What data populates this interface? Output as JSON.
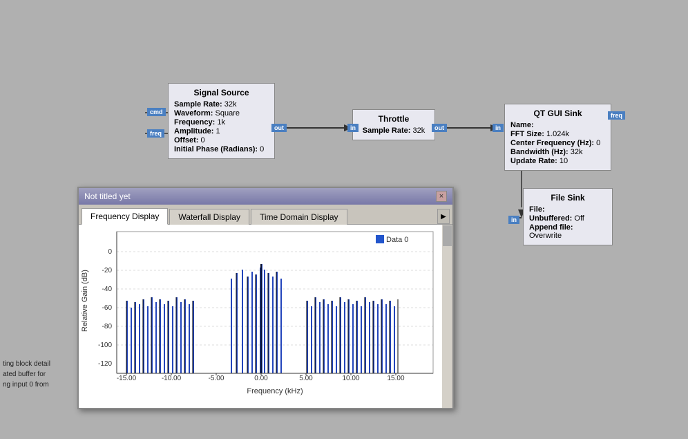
{
  "blocks": {
    "signal_source": {
      "title": "Signal Source",
      "props": [
        {
          "label": "Sample Rate:",
          "value": "32k"
        },
        {
          "label": "Waveform:",
          "value": "Square"
        },
        {
          "label": "Frequency:",
          "value": "1k"
        },
        {
          "label": "Amplitude:",
          "value": "1"
        },
        {
          "label": "Offset:",
          "value": "0"
        },
        {
          "label": "Initial Phase (Radians):",
          "value": "0"
        }
      ],
      "ports": {
        "left": [
          "cmd",
          "freq"
        ],
        "right": [
          "out"
        ]
      }
    },
    "throttle": {
      "title": "Throttle",
      "props": [
        {
          "label": "Sample Rate:",
          "value": "32k"
        }
      ],
      "ports": {
        "left": [
          "in"
        ],
        "right": [
          "out"
        ]
      }
    },
    "qt_gui_sink": {
      "title": "QT GUI Sink",
      "props": [
        {
          "label": "Name:",
          "value": ""
        },
        {
          "label": "FFT Size:",
          "value": "1.024k"
        },
        {
          "label": "Center Frequency (Hz):",
          "value": "0"
        },
        {
          "label": "Bandwidth (Hz):",
          "value": "32k"
        },
        {
          "label": "Update Rate:",
          "value": "10"
        }
      ],
      "ports": {
        "left": [
          "in"
        ],
        "right": [
          "freq"
        ]
      }
    },
    "file_sink": {
      "title": "File Sink",
      "props": [
        {
          "label": "File:",
          "value": ""
        },
        {
          "label": "Unbuffered:",
          "value": "Off"
        },
        {
          "label": "Append file:",
          "value": "Overwrite"
        }
      ],
      "ports": {
        "left": [
          "in"
        ]
      }
    }
  },
  "popup": {
    "title": "Not titled yet",
    "close_label": "×",
    "tabs": [
      {
        "label": "Frequency Display",
        "active": true
      },
      {
        "label": "Waterfall Display",
        "active": false
      },
      {
        "label": "Time Domain Display",
        "active": false
      }
    ],
    "scroll_btn": "▶",
    "chart": {
      "legend": "Data 0",
      "y_axis_label": "Relative Gain (dB)",
      "x_axis_label": "Frequency (kHz)",
      "y_ticks": [
        "0",
        "-20",
        "-40",
        "-60",
        "-80",
        "-100",
        "-120"
      ],
      "x_ticks": [
        "-15.00",
        "-10.00",
        "-5.00",
        "0.00",
        "5.00",
        "10.00",
        "15.00"
      ]
    }
  },
  "log": {
    "lines": [
      "ting block detail",
      "ated buffer for",
      "ng input 0 from"
    ]
  }
}
